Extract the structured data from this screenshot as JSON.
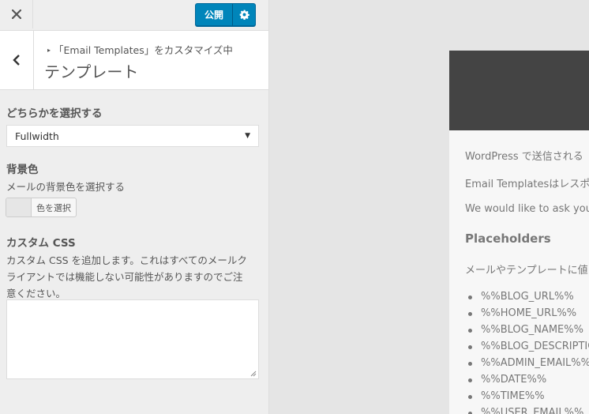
{
  "topbar": {
    "close_icon": "close-icon",
    "publish_label": "公開",
    "settings_icon": "gear-icon"
  },
  "section": {
    "back_icon": "chevron-left-icon",
    "breadcrumb": "「Email Templates」をカスタマイズ中",
    "title": "テンプレート"
  },
  "controls": {
    "layout": {
      "title": "どちらかを選択する",
      "selected": "Fullwidth"
    },
    "background": {
      "title": "背景色",
      "description": "メールの背景色を選択する",
      "button_label": "色を選択",
      "swatch_color": "#e6e6e6"
    },
    "custom_css": {
      "title": "カスタム CSS",
      "description_lines": [
        "カスタム CSS を追加します。これはすべてのメールク",
        "ライアントでは機能しない可能性がありますのでご注",
        "意ください。"
      ],
      "value": ""
    }
  },
  "preview": {
    "header_color": "#444444",
    "lines": [
      "WordPress で送信される",
      "Email Templatesはレスポ",
      "We would like to ask you"
    ],
    "placeholders_title": "Placeholders",
    "placeholders_intro": "メールやテンプレートに値",
    "placeholders": [
      "%%BLOG_URL%%",
      "%%HOME_URL%%",
      "%%BLOG_NAME%%",
      "%%BLOG_DESCRIPTION%%",
      "%%ADMIN_EMAIL%%",
      "%%DATE%%",
      "%%TIME%%",
      "%%USER_EMAIL%%"
    ]
  },
  "colors": {
    "accent": "#0085ba",
    "panel_bg": "#eeeeee",
    "preview_bg": "#e5e5e5"
  }
}
